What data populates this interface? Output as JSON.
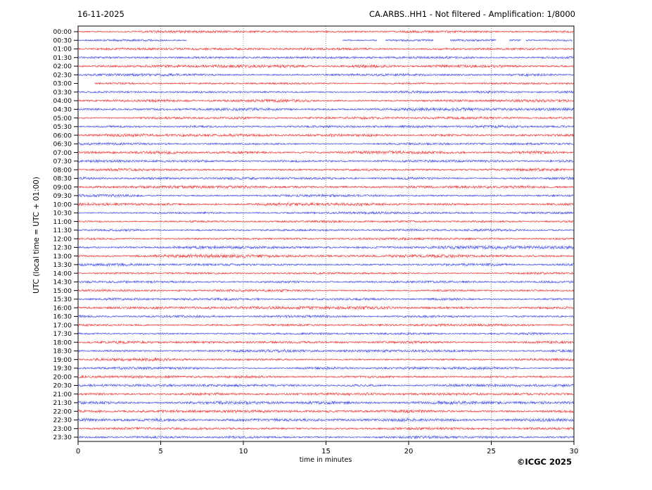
{
  "header": {
    "date": "16-11-2025",
    "title": "CA.ARBS..HH1 - Not filtered - Amplification: 1/8000"
  },
  "footer": {
    "copyright": "©ICGC 2025"
  },
  "chart_data": {
    "type": "line",
    "subtype": "helicorder-seismogram",
    "title": "CA.ARBS..HH1 - Not filtered - Amplification: 1/8000",
    "date": "16-11-2025",
    "xlabel": "time in minutes",
    "ylabel": "UTC (local time = UTC + 01:00)",
    "xlim": [
      0,
      30
    ],
    "x_ticks": [
      0,
      5,
      10,
      15,
      20,
      25,
      30
    ],
    "grid_minutes": [
      5,
      10,
      15,
      20,
      25
    ],
    "grid_color": "#808080",
    "frame_color": "#000000",
    "trace_colors": {
      "red": "#e03232",
      "blue": "#3a46d8"
    },
    "rows": [
      {
        "time": "00:00",
        "color": "red",
        "amp": 1.2,
        "segments": [
          [
            0,
            30
          ]
        ]
      },
      {
        "time": "00:30",
        "color": "blue",
        "amp": 1.0,
        "segments": [
          [
            0,
            6.6
          ],
          [
            16.0,
            18.1
          ],
          [
            18.6,
            21.5
          ],
          [
            22.5,
            25.3
          ],
          [
            26.1,
            26.8
          ],
          [
            27.1,
            29.9
          ]
        ]
      },
      {
        "time": "01:00",
        "color": "red",
        "amp": 1.1,
        "segments": [
          [
            0,
            30
          ]
        ]
      },
      {
        "time": "01:30",
        "color": "blue",
        "amp": 1.3,
        "segments": [
          [
            0,
            30
          ]
        ]
      },
      {
        "time": "02:00",
        "color": "red",
        "amp": 1.4,
        "segments": [
          [
            0,
            30
          ]
        ]
      },
      {
        "time": "02:30",
        "color": "blue",
        "amp": 1.2,
        "segments": [
          [
            0,
            30
          ]
        ]
      },
      {
        "time": "03:00",
        "color": "red",
        "amp": 1.0,
        "segments": [
          [
            1.0,
            30
          ]
        ]
      },
      {
        "time": "03:30",
        "color": "blue",
        "amp": 1.2,
        "segments": [
          [
            0,
            30
          ]
        ]
      },
      {
        "time": "04:00",
        "color": "red",
        "amp": 1.5,
        "segments": [
          [
            0,
            30
          ]
        ]
      },
      {
        "time": "04:30",
        "color": "blue",
        "amp": 1.5,
        "segments": [
          [
            0,
            30
          ]
        ]
      },
      {
        "time": "05:00",
        "color": "red",
        "amp": 1.1,
        "segments": [
          [
            0,
            30
          ]
        ]
      },
      {
        "time": "05:30",
        "color": "blue",
        "amp": 1.2,
        "segments": [
          [
            0,
            30
          ]
        ]
      },
      {
        "time": "06:00",
        "color": "red",
        "amp": 1.3,
        "segments": [
          [
            0,
            30
          ]
        ]
      },
      {
        "time": "06:30",
        "color": "blue",
        "amp": 1.1,
        "segments": [
          [
            0,
            30
          ]
        ]
      },
      {
        "time": "07:00",
        "color": "red",
        "amp": 1.5,
        "segments": [
          [
            0,
            30
          ]
        ]
      },
      {
        "time": "07:30",
        "color": "blue",
        "amp": 1.2,
        "segments": [
          [
            0,
            30
          ]
        ]
      },
      {
        "time": "08:00",
        "color": "red",
        "amp": 1.3,
        "segments": [
          [
            0,
            30
          ]
        ]
      },
      {
        "time": "08:30",
        "color": "blue",
        "amp": 1.2,
        "segments": [
          [
            0,
            30
          ]
        ]
      },
      {
        "time": "09:00",
        "color": "red",
        "amp": 1.3,
        "segments": [
          [
            0,
            30
          ]
        ]
      },
      {
        "time": "09:30",
        "color": "blue",
        "amp": 1.3,
        "segments": [
          [
            0,
            30
          ]
        ]
      },
      {
        "time": "10:00",
        "color": "red",
        "amp": 1.5,
        "segments": [
          [
            0,
            30
          ]
        ]
      },
      {
        "time": "10:30",
        "color": "blue",
        "amp": 1.1,
        "segments": [
          [
            0,
            30
          ]
        ]
      },
      {
        "time": "11:00",
        "color": "red",
        "amp": 1.1,
        "segments": [
          [
            0,
            30
          ]
        ]
      },
      {
        "time": "11:30",
        "color": "blue",
        "amp": 1.1,
        "segments": [
          [
            0,
            30
          ]
        ]
      },
      {
        "time": "12:00",
        "color": "red",
        "amp": 1.2,
        "segments": [
          [
            0,
            30
          ]
        ]
      },
      {
        "time": "12:30",
        "color": "blue",
        "amp": 1.5,
        "segments": [
          [
            0,
            30
          ]
        ]
      },
      {
        "time": "13:00",
        "color": "red",
        "amp": 1.5,
        "segments": [
          [
            0,
            30
          ]
        ]
      },
      {
        "time": "13:30",
        "color": "blue",
        "amp": 1.3,
        "segments": [
          [
            0,
            30
          ]
        ]
      },
      {
        "time": "14:00",
        "color": "red",
        "amp": 1.0,
        "segments": [
          [
            0,
            30
          ]
        ]
      },
      {
        "time": "14:30",
        "color": "blue",
        "amp": 1.1,
        "segments": [
          [
            0,
            30
          ]
        ]
      },
      {
        "time": "15:00",
        "color": "red",
        "amp": 1.1,
        "segments": [
          [
            0,
            30
          ]
        ]
      },
      {
        "time": "15:30",
        "color": "blue",
        "amp": 1.2,
        "segments": [
          [
            0,
            30
          ]
        ]
      },
      {
        "time": "16:00",
        "color": "red",
        "amp": 1.4,
        "segments": [
          [
            0,
            30
          ]
        ]
      },
      {
        "time": "16:30",
        "color": "blue",
        "amp": 1.2,
        "segments": [
          [
            0,
            30
          ]
        ]
      },
      {
        "time": "17:00",
        "color": "red",
        "amp": 1.1,
        "segments": [
          [
            0,
            30
          ]
        ]
      },
      {
        "time": "17:30",
        "color": "blue",
        "amp": 1.1,
        "segments": [
          [
            0,
            30
          ]
        ]
      },
      {
        "time": "18:00",
        "color": "red",
        "amp": 1.2,
        "segments": [
          [
            0,
            30
          ]
        ]
      },
      {
        "time": "18:30",
        "color": "blue",
        "amp": 1.3,
        "segments": [
          [
            0,
            30
          ]
        ]
      },
      {
        "time": "19:00",
        "color": "red",
        "amp": 1.3,
        "segments": [
          [
            0,
            30
          ]
        ]
      },
      {
        "time": "19:30",
        "color": "blue",
        "amp": 1.2,
        "segments": [
          [
            0,
            30
          ]
        ]
      },
      {
        "time": "20:00",
        "color": "red",
        "amp": 1.1,
        "segments": [
          [
            0,
            30
          ]
        ]
      },
      {
        "time": "20:30",
        "color": "blue",
        "amp": 1.2,
        "segments": [
          [
            0,
            30
          ]
        ]
      },
      {
        "time": "21:00",
        "color": "red",
        "amp": 1.2,
        "segments": [
          [
            0,
            30
          ]
        ]
      },
      {
        "time": "21:30",
        "color": "blue",
        "amp": 1.5,
        "segments": [
          [
            0,
            30
          ]
        ]
      },
      {
        "time": "22:00",
        "color": "red",
        "amp": 1.4,
        "segments": [
          [
            0,
            30
          ]
        ]
      },
      {
        "time": "22:30",
        "color": "blue",
        "amp": 1.5,
        "segments": [
          [
            0,
            30
          ]
        ]
      },
      {
        "time": "23:00",
        "color": "red",
        "amp": 1.1,
        "segments": [
          [
            0,
            30
          ]
        ]
      },
      {
        "time": "23:30",
        "color": "blue",
        "amp": 1.3,
        "segments": [
          [
            0,
            30
          ]
        ]
      }
    ]
  }
}
